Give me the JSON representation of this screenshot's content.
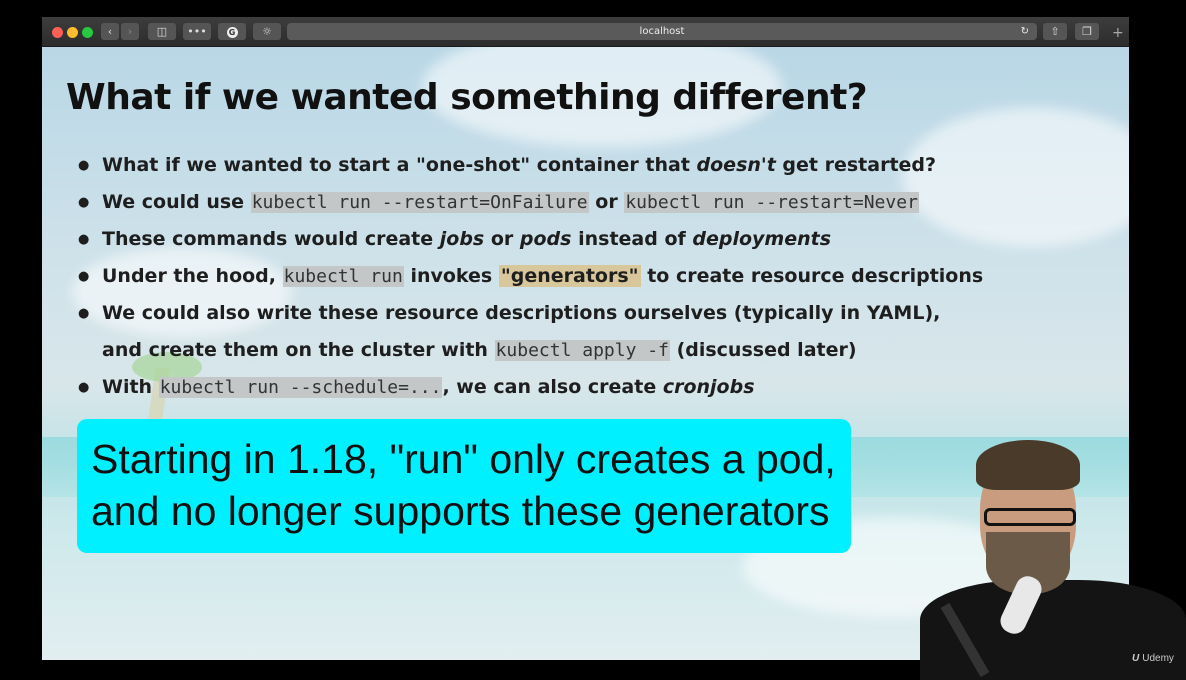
{
  "browser": {
    "address": "localhost",
    "icons": [
      "close-light",
      "minimize-light",
      "maximize-light",
      "back-icon",
      "forward-icon",
      "sidebar-icon",
      "dots-icon",
      "grammarly-icon",
      "brightness-icon",
      "reload-icon",
      "share-icon",
      "tabs-icon",
      "new-tab-icon"
    ]
  },
  "slide": {
    "title": "What if we wanted something different?",
    "bullets": [
      {
        "p1": "What if we wanted to start a \"one-shot\" container that ",
        "em1": "doesn't",
        "p2": " get restarted?"
      },
      {
        "p1": "We could use ",
        "code1": "kubectl run --restart=OnFailure",
        "p2": " or ",
        "code2": "kubectl run --restart=Never"
      },
      {
        "p1": "These commands would create ",
        "em1": "jobs",
        "p2": " or ",
        "em2": "pods",
        "p3": " instead of ",
        "em3": "deployments"
      },
      {
        "p1": "Under the hood, ",
        "code1": "kubectl run",
        "p2": " invokes ",
        "hl1": "\"generators\"",
        "p3": " to create resource descriptions"
      },
      {
        "p1": "We could also write these resource descriptions ourselves (typically in YAML),",
        "p2": "and create them on the cluster with ",
        "code1": "kubectl apply -f",
        "p3": " (discussed later)"
      },
      {
        "p1": "With ",
        "code1": "kubectl run --schedule=...",
        "p2": ", we can also create ",
        "em1": "cronjobs"
      }
    ],
    "callout": {
      "line1": "Starting in 1.18, \"run\" only creates a pod,",
      "line2": "and no longer supports these generators"
    }
  },
  "watermark": "Udemy",
  "colors": {
    "callout_bg": "#00f0ff",
    "code_bg": "#c4c7c8",
    "highlight_bg": "#d9c79c"
  }
}
